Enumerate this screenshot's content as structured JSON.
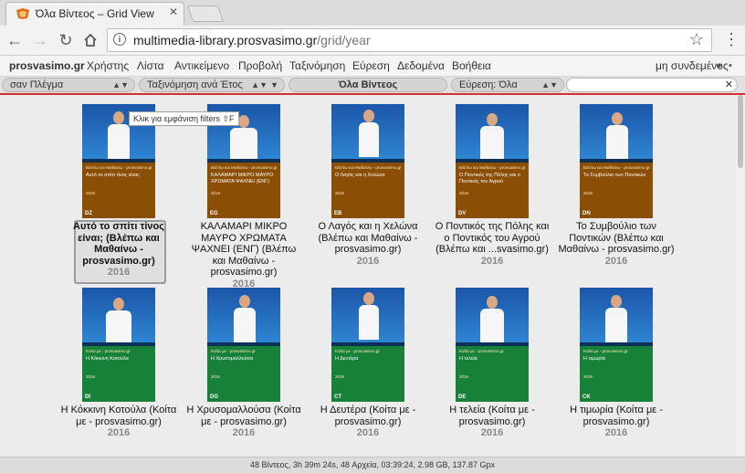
{
  "browser": {
    "tab_title": "Όλα Βίντεος – Grid View",
    "url_host": "multimedia-library.prosvasimo.gr",
    "url_path": "/grid/year"
  },
  "menu": {
    "brand": "prosvasimo.gr",
    "items": [
      "Χρήστης",
      "Λίστα",
      "Αντικείμενο",
      "Προβολή",
      "Ταξινόμηση",
      "Εύρεση",
      "Δεδομένα",
      "Βοήθεια"
    ],
    "login": "μη συνδεμένος"
  },
  "filterbar": {
    "view": "σαν Πλέγμα",
    "sort": "Ταξινόμηση ανά Έτος",
    "center": "Όλα Βίντεος",
    "find": "Εύρεση: Όλα",
    "search_value": ""
  },
  "tooltip": "Κλικ για εμφάνιση filters ⇧F",
  "videos": [
    {
      "caption": "Αυτό το σπίτι τίνος είναι; (Βλέπω και Μαθαίνω - prosvasimo.gr)",
      "year": "2016",
      "poster_title": "Αυτό το σπίτι τίνος είναι;",
      "poster_series": "Βλέπω και Μαθαίνω - prosvasimo.gr",
      "code": "DZ",
      "color": "#8a4e05"
    },
    {
      "caption": "ΚΑΛΑΜΑΡΙ ΜΙΚΡΟ ΜΑΥΡΟ ΧΡΩΜΑΤΑ ΨΑΧΝΕΙ (ΕΝΓ) (Βλέπω και Μαθαίνω - prosvasimo.gr)",
      "year": "2016",
      "poster_title": "ΚΑΛΑΜΑΡΙ ΜΙΚΡΟ ΜΑΥΡΟ ΧΡΩΜΑΤΑ ΨΑΧΝΕΙ (ΕΝΓ)",
      "poster_series": "Βλέπω και Μαθαίνω - prosvasimo.gr",
      "code": "EG",
      "color": "#8a4e05"
    },
    {
      "caption": "Ο Λαγός και η Χελώνα (Βλέπω και Μαθαίνω - prosvasimo.gr)",
      "year": "2016",
      "poster_title": "Ο Λαγός και η Χελώνα",
      "poster_series": "Βλέπω και Μαθαίνω - prosvasimo.gr",
      "code": "EB",
      "color": "#8a4e05"
    },
    {
      "caption": "Ο Ποντικός της Πόλης και ο Ποντικός του Αγρού (Βλέπω και ...svasimo.gr)",
      "year": "2016",
      "poster_title": "Ο Ποντικός της Πόλης και ο Ποντικός του Αγρού",
      "poster_series": "Βλέπω και Μαθαίνω - prosvasimo.gr",
      "code": "DV",
      "color": "#8a4e05"
    },
    {
      "caption": "Το Συμβούλιο των Ποντικών (Βλέπω και Μαθαίνω - prosvasimo.gr)",
      "year": "2016",
      "poster_title": "Το Συμβούλιο των Ποντικών",
      "poster_series": "Βλέπω και Μαθαίνω - prosvasimo.gr",
      "code": "DN",
      "color": "#8a4e05"
    },
    {
      "caption": "Η Κόκκινη Κοτούλα (Κοίτα με - prosvasimo.gr)",
      "year": "2016",
      "poster_title": "Η Κόκκινη Κοτούλα",
      "poster_series": "Κοίτα με - prosvasimo.gr",
      "code": "DI",
      "color": "#17813a"
    },
    {
      "caption": "Η Χρυσομαλλούσα (Κοίτα με - prosvasimo.gr)",
      "year": "2016",
      "poster_title": "Η Χρυσομαλλούσα",
      "poster_series": "Κοίτα με - prosvasimo.gr",
      "code": "DG",
      "color": "#17813a"
    },
    {
      "caption": "Η Δευτέρα (Κοίτα με - prosvasimo.gr)",
      "year": "2016",
      "poster_title": "Η Δευτέρα",
      "poster_series": "Κοίτα με - prosvasimo.gr",
      "code": "CT",
      "color": "#17813a"
    },
    {
      "caption": "Η τελεία (Κοίτα με - prosvasimo.gr)",
      "year": "2016",
      "poster_title": "Η τελεία",
      "poster_series": "Κοίτα με - prosvasimo.gr",
      "code": "DE",
      "color": "#17813a"
    },
    {
      "caption": "Η τιμωρία (Κοίτα με - prosvasimo.gr)",
      "year": "2016",
      "poster_title": "Η τιμωρία",
      "poster_series": "Κοίτα με - prosvasimo.gr",
      "code": "CK",
      "color": "#17813a"
    }
  ],
  "status": "48 Βίντεος, 3h 39m 24s, 48 Αρχεία, 03:39:24, 2.98 GB, 137.87 Gpx"
}
